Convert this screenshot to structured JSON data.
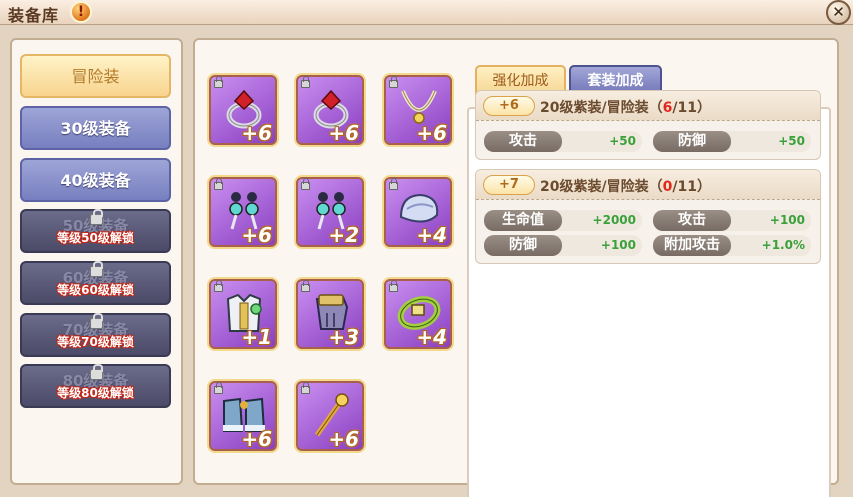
{
  "window": {
    "title": "装备库",
    "info_icon": "!",
    "close_icon": "✕"
  },
  "categories": [
    {
      "label": "冒险装",
      "state": "active"
    },
    {
      "label": "30级装备",
      "state": "normal"
    },
    {
      "label": "40级装备",
      "state": "normal"
    },
    {
      "label": "50级装备",
      "state": "locked",
      "unlock_text": "等级50级解锁"
    },
    {
      "label": "60级装备",
      "state": "locked",
      "unlock_text": "等级60级解锁"
    },
    {
      "label": "70级装备",
      "state": "locked",
      "unlock_text": "等级70级解锁"
    },
    {
      "label": "80级装备",
      "state": "locked",
      "unlock_text": "等级80级解锁"
    }
  ],
  "items": [
    {
      "icon": "ring-red-gem-icon",
      "level": "+6"
    },
    {
      "icon": "ring-red-gem-icon",
      "level": "+6"
    },
    {
      "icon": "necklace-icon",
      "level": "+6"
    },
    {
      "icon": "earring-icon",
      "level": "+6"
    },
    {
      "icon": "earring-icon",
      "level": "+2"
    },
    {
      "icon": "helmet-icon",
      "level": "+4"
    },
    {
      "icon": "armor-icon",
      "level": "+1"
    },
    {
      "icon": "gloves-icon",
      "level": "+3"
    },
    {
      "icon": "belt-icon",
      "level": "+4"
    },
    {
      "icon": "boots-icon",
      "level": "+6"
    },
    {
      "icon": "staff-icon",
      "level": "+6"
    }
  ],
  "tabs": {
    "enhance": "强化加成",
    "set": "套装加成"
  },
  "bonuses": [
    {
      "badge": "+6",
      "title": "20级紫装/冒险装（",
      "current": "6",
      "total": "/11）",
      "stats": [
        {
          "name": "攻击",
          "value": "+50"
        },
        {
          "name": "防御",
          "value": "+50"
        }
      ]
    },
    {
      "badge": "+7",
      "title": "20级紫装/冒险装（",
      "current": "0",
      "total": "/11）",
      "stats": [
        {
          "name": "生命值",
          "value": "+2000"
        },
        {
          "name": "攻击",
          "value": "+100"
        },
        {
          "name": "防御",
          "value": "+100"
        },
        {
          "name": "附加攻击",
          "value": "+1.0%"
        }
      ]
    }
  ],
  "colors": {
    "active_category": "#f8d48d",
    "normal_category": "#777fc0",
    "locked_category": "#4b4b68",
    "slot_purple": "#a356d8",
    "stat_value": "#3aa13a",
    "progress_red": "#e0281b"
  }
}
